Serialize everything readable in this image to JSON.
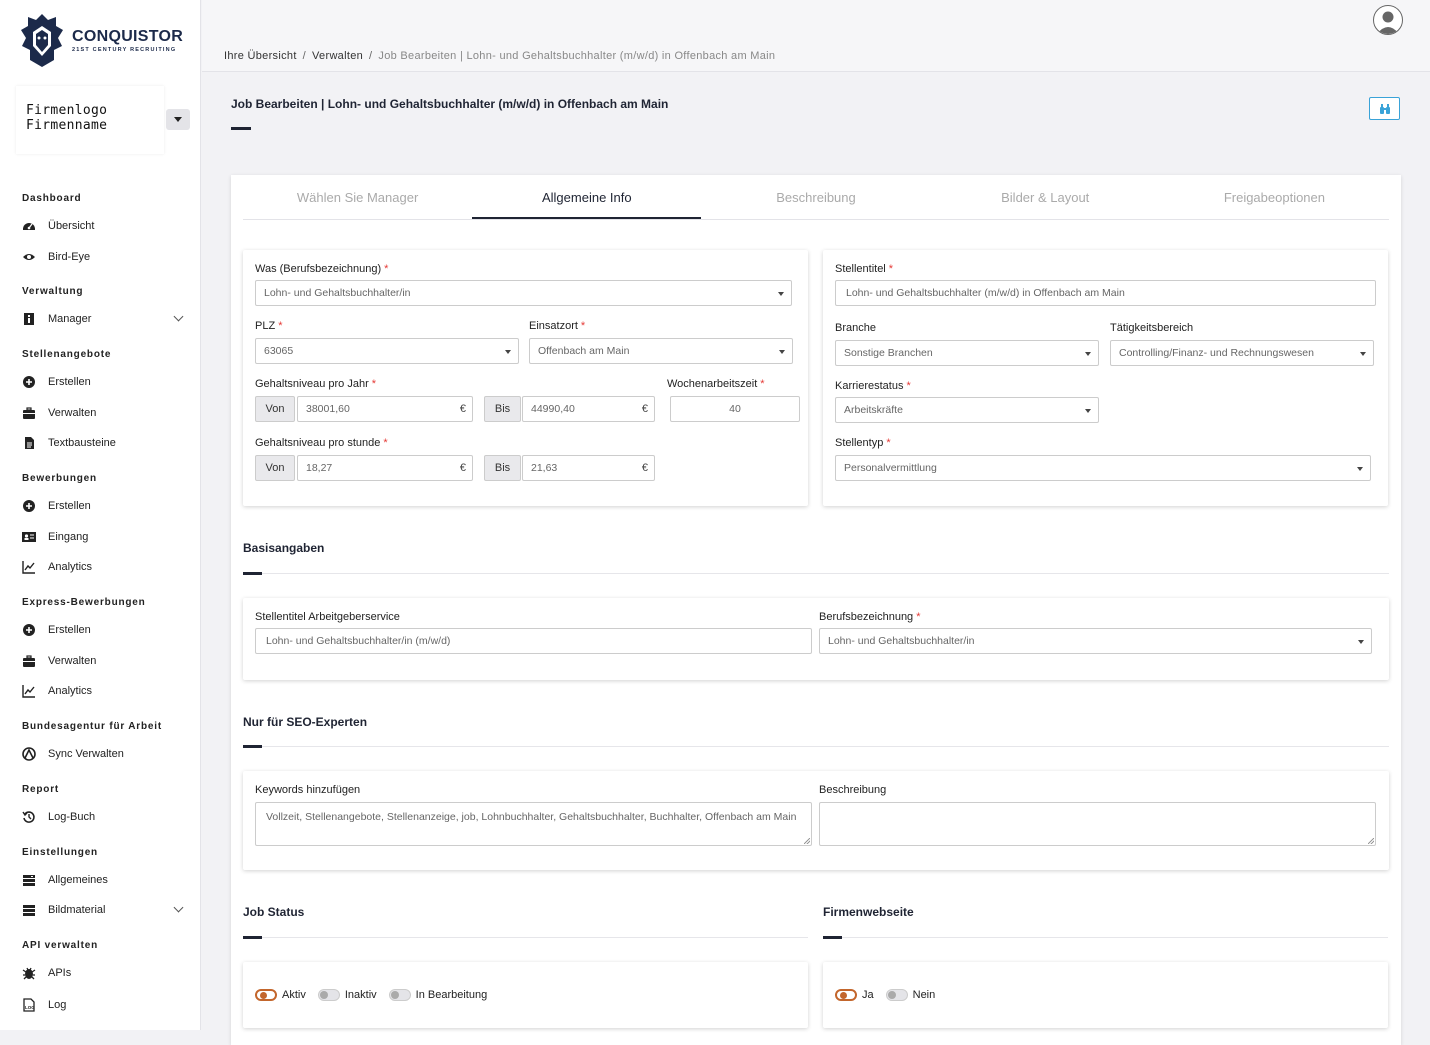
{
  "brand": {
    "name": "CONQUISTOR",
    "tagline": "21ST CENTURY RECRUITING"
  },
  "company": {
    "line1": "Firmenlogo",
    "line2": "Firmenname"
  },
  "sidebar": {
    "groups": [
      {
        "title": "Dashboard",
        "items": [
          {
            "label": "Übersicht",
            "icon": "dashboard-icon"
          },
          {
            "label": "Bird-Eye",
            "icon": "eye-icon"
          }
        ]
      },
      {
        "title": "Verwaltung",
        "items": [
          {
            "label": "Manager",
            "icon": "manager-icon"
          }
        ]
      },
      {
        "title": "Stellenangebote",
        "items": [
          {
            "label": "Erstellen",
            "icon": "plus-circle-icon"
          },
          {
            "label": "Verwalten",
            "icon": "briefcase-icon"
          },
          {
            "label": "Textbausteine",
            "icon": "file-icon"
          }
        ]
      },
      {
        "title": "Bewerbungen",
        "items": [
          {
            "label": "Erstellen",
            "icon": "plus-circle-icon"
          },
          {
            "label": "Eingang",
            "icon": "id-card-icon"
          },
          {
            "label": "Analytics",
            "icon": "chart-line-icon"
          }
        ]
      },
      {
        "title": "Express-Bewerbungen",
        "items": [
          {
            "label": "Erstellen",
            "icon": "plus-circle-icon"
          },
          {
            "label": "Verwalten",
            "icon": "briefcase-icon"
          },
          {
            "label": "Analytics",
            "icon": "chart-line-icon"
          }
        ]
      },
      {
        "title": "Bundesagentur für Arbeit",
        "items": [
          {
            "label": "Sync Verwalten",
            "icon": "agency-icon"
          }
        ]
      },
      {
        "title": "Report",
        "items": [
          {
            "label": "Log-Buch",
            "icon": "history-icon"
          }
        ]
      },
      {
        "title": "Einstellungen",
        "items": [
          {
            "label": "Allgemeines",
            "icon": "settings-list-icon"
          },
          {
            "label": "Bildmaterial",
            "icon": "images-icon"
          }
        ]
      },
      {
        "title": "API verwalten",
        "items": [
          {
            "label": "APIs",
            "icon": "bug-icon"
          },
          {
            "label": "Log",
            "icon": "log-file-icon"
          }
        ]
      }
    ]
  },
  "breadcrumb": {
    "home": "Ihre Übersicht",
    "section": "Verwalten",
    "current": "Job Bearbeiten | Lohn- und Gehaltsbuchhalter (m/w/d) in Offenbach am Main"
  },
  "page_title": "Job Bearbeiten | Lohn- und Gehaltsbuchhalter (m/w/d) in Offenbach am Main",
  "tabs": [
    "Wählen Sie Manager",
    "Allgemeine Info",
    "Beschreibung",
    "Bilder & Layout",
    "Freigabeoptionen"
  ],
  "active_tab": "Allgemeine Info",
  "form": {
    "was_label": "Was (Berufsbezeichnung)",
    "was_value": "Lohn- und Gehaltsbuchhalter/in",
    "plz_label": "PLZ",
    "plz_value": "63065",
    "einsatzort_label": "Einsatzort",
    "einsatzort_value": "Offenbach am Main",
    "gehalt_jahr_label": "Gehaltsniveau pro Jahr",
    "gehalt_jahr_von": "38001,60",
    "gehalt_jahr_bis": "44990,40",
    "wochenarbeitszeit_label": "Wochenarbeitszeit",
    "wochenarbeitszeit_value": "40",
    "gehalt_stunde_label": "Gehaltsniveau pro stunde",
    "gehalt_stunde_von": "18,27",
    "gehalt_stunde_bis": "21,63",
    "von_label": "Von",
    "bis_label": "Bis",
    "currency": "€",
    "stellentitel_label": "Stellentitel",
    "stellentitel_value": "Lohn- und Gehaltsbuchhalter (m/w/d) in Offenbach am Main",
    "branche_label": "Branche",
    "branche_value": "Sonstige Branchen",
    "taetigkeit_label": "Tätigkeitsbereich",
    "taetigkeit_value": "Controlling/Finanz- und Rechnungswesen",
    "karriere_label": "Karrierestatus",
    "karriere_value": "Arbeitskräfte",
    "stellentyp_label": "Stellentyp",
    "stellentyp_value": "Personalvermittlung"
  },
  "basis": {
    "title": "Basisangaben",
    "arbeitgeber_label": "Stellentitel Arbeitgeberservice",
    "arbeitgeber_value": "Lohn- und Gehaltsbuchhalter/in (m/w/d)",
    "beruf_label": "Berufsbezeichnung",
    "beruf_value": "Lohn- und Gehaltsbuchhalter/in"
  },
  "seo": {
    "title": "Nur für SEO-Experten",
    "keywords_label": "Keywords hinzufügen",
    "keywords_value": "Vollzeit, Stellenangebote, Stellenanzeige, job, Lohnbuchhalter, Gehaltsbuchhalter, Buchhalter, Offenbach am Main",
    "beschreibung_label": "Beschreibung",
    "beschreibung_value": ""
  },
  "job_status": {
    "title": "Job Status",
    "options": [
      {
        "label": "Aktiv",
        "on": true
      },
      {
        "label": "Inaktiv",
        "on": false
      },
      {
        "label": "In Bearbeitung",
        "on": false
      }
    ]
  },
  "firmenwebseite": {
    "title": "Firmenwebseite",
    "options": [
      {
        "label": "Ja",
        "on": true
      },
      {
        "label": "Nein",
        "on": false
      }
    ]
  },
  "colors": {
    "accent": "#c3662c",
    "primary": "#1f2433",
    "info": "#3aa3d8",
    "required": "#e53935"
  }
}
